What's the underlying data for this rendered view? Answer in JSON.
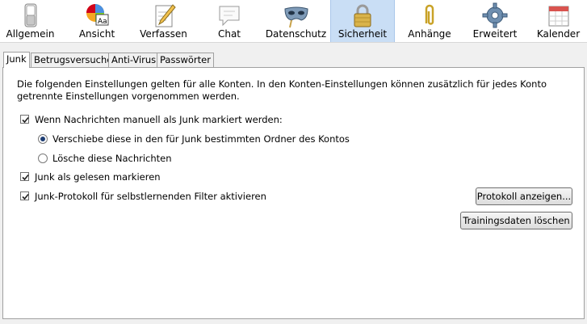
{
  "toolbar": {
    "items": [
      {
        "label": "Allgemein",
        "icon": "switch-icon"
      },
      {
        "label": "Ansicht",
        "icon": "palette-icon"
      },
      {
        "label": "Verfassen",
        "icon": "pencil-paper-icon"
      },
      {
        "label": "Chat",
        "icon": "speech-bubble-icon"
      },
      {
        "label": "Datenschutz",
        "icon": "mask-icon"
      },
      {
        "label": "Sicherheit",
        "icon": "padlock-icon"
      },
      {
        "label": "Anhänge",
        "icon": "paperclip-icon"
      },
      {
        "label": "Erweitert",
        "icon": "gear-icon"
      },
      {
        "label": "Kalender",
        "icon": "calendar-icon"
      }
    ],
    "selected": "Sicherheit"
  },
  "tabs": [
    "Junk",
    "Betrugsversuche",
    "Anti-Virus",
    "Passwörter"
  ],
  "active_tab": "Junk",
  "junk": {
    "intro": "Die folgenden Einstellungen gelten für alle Konten. In den Konten-Einstellungen können zusätzlich für jedes Konto getrennte Einstellungen vorgenommen werden.",
    "manual_mark": {
      "label": "Wenn Nachrichten manuell als Junk markiert werden:",
      "checked": true
    },
    "move_option": {
      "label": "Verschiebe diese in den für Junk bestimmten Ordner des Kontos",
      "selected": true
    },
    "delete_option": {
      "label": "Lösche diese Nachrichten",
      "selected": false
    },
    "mark_read": {
      "label": "Junk als gelesen markieren",
      "checked": true
    },
    "log": {
      "label": "Junk-Protokoll für selbstlernenden Filter aktivieren",
      "checked": true
    },
    "show_log_button": "Protokoll anzeigen...",
    "reset_training_button": "Trainingsdaten löschen"
  },
  "colors": {
    "selected_tab_bg": "#c9def5",
    "accent": "#1d3d73"
  }
}
